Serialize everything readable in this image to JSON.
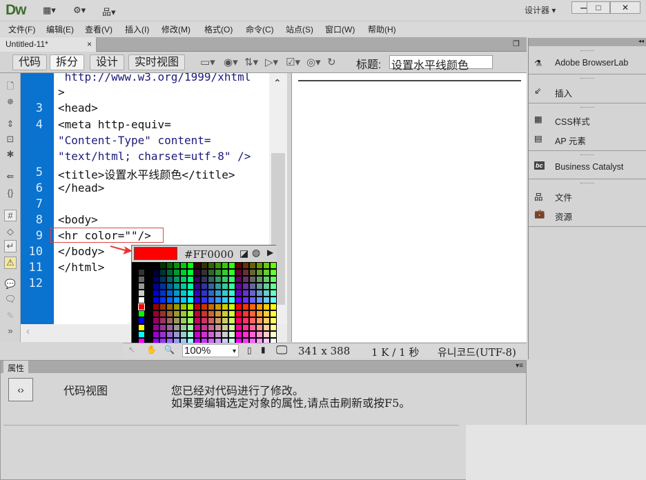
{
  "app": {
    "logo": "Dw",
    "workspace": "设计器 ▾",
    "icons": [
      "layout-icon",
      "gear-icon",
      "site-icon"
    ]
  },
  "window_controls": {
    "minimize": "—",
    "maximize": "□",
    "close": "✕"
  },
  "menu": [
    "文件(F)",
    "编辑(E)",
    "查看(V)",
    "插入(I)",
    "修改(M)",
    "格式(O)",
    "命令(C)",
    "站点(S)",
    "窗口(W)",
    "帮助(H)"
  ],
  "doc_tab": {
    "name": "Untitled-11*",
    "close": "×"
  },
  "toolbar": {
    "views": [
      "代码",
      "拆分",
      "设计",
      "实时视图"
    ],
    "active_view": "拆分",
    "title_label": "标题:",
    "title_value": "设置水平线颜色"
  },
  "code": {
    "lines": [
      {
        "num": "",
        "text": " http://www.w3.org/1999/xhtml"
      },
      {
        "num": "",
        "text": ">"
      },
      {
        "num": "3",
        "text": "<head>"
      },
      {
        "num": "4",
        "text": "<meta http-equiv="
      },
      {
        "num": "",
        "text": "\"Content-Type\" content="
      },
      {
        "num": "",
        "text": "\"text/html; charset=utf-8\" />"
      },
      {
        "num": "5",
        "text": "<title>设置水平线颜色</title>"
      },
      {
        "num": "6",
        "text": "</head>"
      },
      {
        "num": "7",
        "text": ""
      },
      {
        "num": "8",
        "text": "<body>"
      },
      {
        "num": "9",
        "text": "<hr color=\"\"/>"
      },
      {
        "num": "10",
        "text": "</body>"
      },
      {
        "num": "11",
        "text": "</html>"
      },
      {
        "num": "12",
        "text": ""
      }
    ]
  },
  "color_picker": {
    "selected": "#FF0000",
    "hex_label": "#FF0000",
    "palette": "web-safe-216",
    "side_colors": [
      "#000000",
      "#333333",
      "#666666",
      "#999999",
      "#cccccc",
      "#ffffff",
      "#ff0000",
      "#00ff00",
      "#0000ff",
      "#ffff00",
      "#00ffff",
      "#ff00ff"
    ]
  },
  "status": {
    "zoom": "100%",
    "size": "341 x 388",
    "file": "1 K / 1 秒",
    "encoding": "유니코드(UTF-8)"
  },
  "properties": {
    "tab": "属性",
    "mode": "代码视图",
    "message1": "您已经对代码进行了修改。",
    "message2": "如果要编辑选定对象的属性,请点击刷新或按F5。"
  },
  "right_panel": {
    "items": [
      "Adobe BrowserLab",
      "插入",
      "CSS样式",
      "AP 元素",
      "Business Catalyst",
      "文件",
      "资源"
    ]
  },
  "colors": {
    "gutter": "#0a72cf",
    "highlight_box": "#dd4444",
    "accent_logo": "#3f6d2b"
  }
}
